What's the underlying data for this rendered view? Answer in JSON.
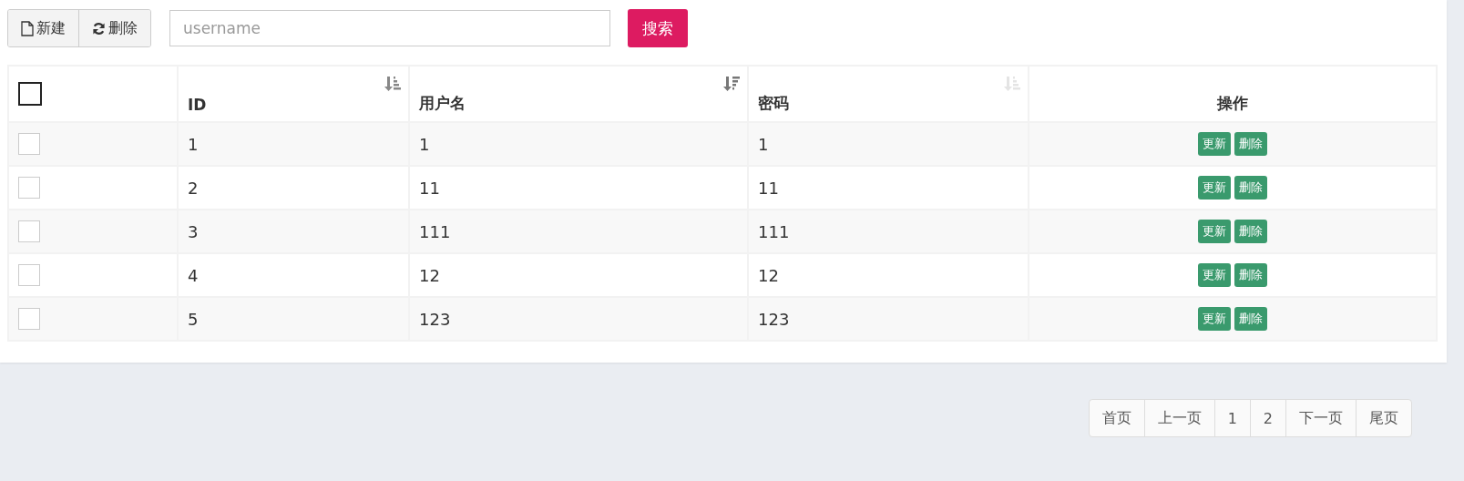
{
  "toolbar": {
    "buttons": [
      {
        "label": "新建",
        "kind": "file"
      },
      {
        "label": "删除",
        "kind": "refresh"
      }
    ],
    "search": {
      "placeholder": "username"
    },
    "search_button": "搜索"
  },
  "table": {
    "select_all": {
      "checked": false
    },
    "columns": [
      {
        "label": "ID",
        "kind": "ascending"
      },
      {
        "label": "用户名",
        "kind": "descending"
      },
      {
        "label": "密码",
        "kind": "unsorted"
      },
      {
        "label": "操作",
        "kind": "plain"
      }
    ],
    "rows": [
      {
        "checked": false,
        "cells": [
          "1",
          "1",
          "1"
        ],
        "actions": [
          "更新",
          "删除"
        ]
      },
      {
        "checked": false,
        "cells": [
          "2",
          "11",
          "11"
        ],
        "actions": [
          "更新",
          "删除"
        ]
      },
      {
        "checked": false,
        "cells": [
          "3",
          "111",
          "111"
        ],
        "actions": [
          "更新",
          "删除"
        ]
      },
      {
        "checked": false,
        "cells": [
          "4",
          "12",
          "12"
        ],
        "actions": [
          "更新",
          "删除"
        ]
      },
      {
        "checked": false,
        "cells": [
          "5",
          "123",
          "123"
        ],
        "actions": [
          "更新",
          "删除"
        ]
      }
    ]
  },
  "pagination": [
    "首页",
    "上一页",
    "1",
    "2",
    "下一页",
    "尾页"
  ]
}
